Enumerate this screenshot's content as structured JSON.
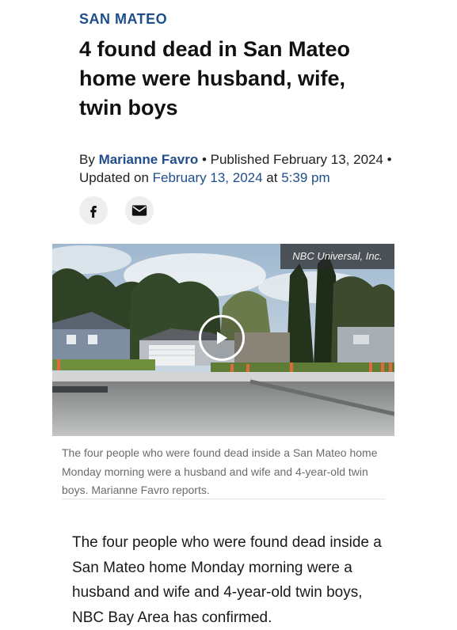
{
  "article": {
    "category": "SAN MATEO",
    "headline": "4 found dead in San Mateo home were husband, wife, twin boys",
    "byline_prefix": "By ",
    "author": "Marianne Favro",
    "published_label": " • Published ",
    "published_date": "February 13, 2024",
    "updated_label": " • Updated on ",
    "updated_date": "February 13, 2024",
    "at_label": " at ",
    "updated_time": "5:39 pm"
  },
  "share": {
    "icons": [
      "facebook-icon",
      "email-icon"
    ]
  },
  "media": {
    "credit": "NBC Universal, Inc.",
    "caption": "The four people who were found dead inside a San Mateo home Monday morning were a husband and wife and 4-year-old twin boys. Marianne Favro reports."
  },
  "body": {
    "paragraph": "The four people who were found dead inside a San Mateo home Monday morning were a husband and wife and 4-year-old twin boys, NBC Bay Area has confirmed."
  },
  "colors": {
    "accent": "#1f4e8c",
    "caption": "#6b6b6b"
  }
}
